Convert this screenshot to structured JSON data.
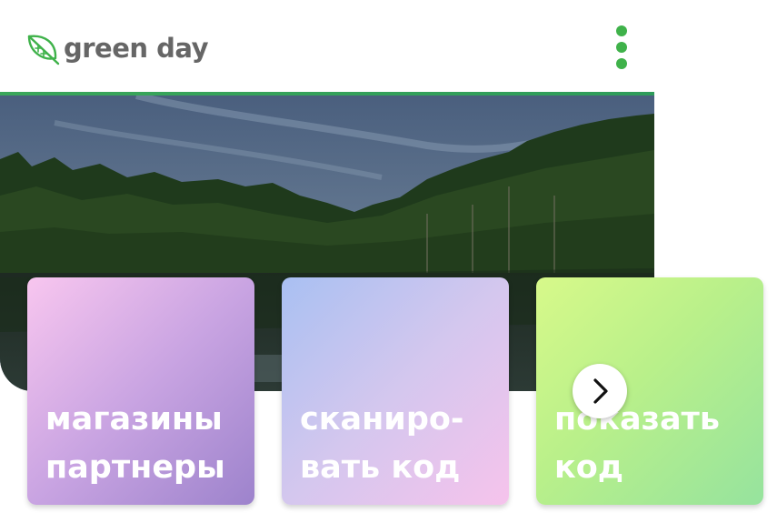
{
  "header": {
    "logo_icon": "leaf-icon",
    "logo_text": "green day",
    "menu_icon": "vertical-dots-icon"
  },
  "colors": {
    "brand_green": "#3fb24a",
    "logo_text": "#666666",
    "tile_text": "#ffffff"
  },
  "hero": {
    "image": "forest-lake-photo"
  },
  "tiles": [
    {
      "label": "магазины\nпартнеры"
    },
    {
      "label": "сканиро-\nвать код"
    },
    {
      "label": "показать\nкод"
    }
  ],
  "carousel": {
    "next_icon": "chevron-right-icon"
  }
}
